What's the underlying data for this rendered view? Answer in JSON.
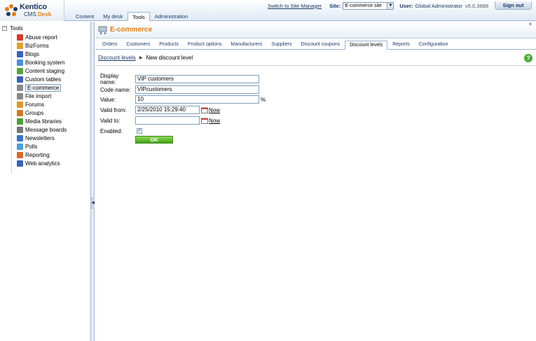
{
  "app": {
    "brand": "Kentico",
    "product_prefix": "CMS",
    "product_suffix": "Desk"
  },
  "main_tabs": [
    "Content",
    "My desk",
    "Tools",
    "Administration"
  ],
  "topbar": {
    "switch_link": "Switch to Site Manager",
    "site_label": "Site:",
    "site_value": "E-commerce site",
    "user_label": "User:",
    "user_value": "Global Administrator",
    "version": "v5.0.3688",
    "sign_out": "Sign out"
  },
  "tree": {
    "root": "Tools",
    "items": [
      {
        "label": "Abuse report",
        "icon": "abuse-report-icon",
        "color": "#d23b2b"
      },
      {
        "label": "BizForms",
        "icon": "bizforms-icon",
        "color": "#e0a030"
      },
      {
        "label": "Blogs",
        "icon": "blogs-icon",
        "color": "#3a62b8"
      },
      {
        "label": "Booking system",
        "icon": "booking-icon",
        "color": "#4a8ed8"
      },
      {
        "label": "Content staging",
        "icon": "staging-icon",
        "color": "#5aa23c"
      },
      {
        "label": "Custom tables",
        "icon": "table-icon",
        "color": "#3a62b8"
      },
      {
        "label": "E-commerce",
        "icon": "cart-icon",
        "color": "#8a8a8a"
      },
      {
        "label": "File import",
        "icon": "file-import-icon",
        "color": "#888888"
      },
      {
        "label": "Forums",
        "icon": "forums-icon",
        "color": "#d89a2a"
      },
      {
        "label": "Groups",
        "icon": "groups-icon",
        "color": "#c87a2a"
      },
      {
        "label": "Media libraries",
        "icon": "media-icon",
        "color": "#4aa03a"
      },
      {
        "label": "Message boards",
        "icon": "message-board-icon",
        "color": "#777777"
      },
      {
        "label": "Newsletters",
        "icon": "newsletter-icon",
        "color": "#3a72c8"
      },
      {
        "label": "Polls",
        "icon": "polls-icon",
        "color": "#4aa0d8"
      },
      {
        "label": "Reporting",
        "icon": "reporting-icon",
        "color": "#d86a2a"
      },
      {
        "label": "Web analytics",
        "icon": "analytics-icon",
        "color": "#3a62b8"
      }
    ]
  },
  "page": {
    "title": "E-commerce",
    "tabs": [
      "Orders",
      "Customers",
      "Products",
      "Product options",
      "Manufacturers",
      "Suppliers",
      "Discount coupons",
      "Discount levels",
      "Reports",
      "Configuration"
    ],
    "breadcrumb": {
      "parent": "Discount levels",
      "current": "New discount level"
    }
  },
  "form": {
    "display_name": {
      "label": "Display name:",
      "value": "VIP customers"
    },
    "code_name": {
      "label": "Code name:",
      "value": "VIPcustomers"
    },
    "value": {
      "label": "Value:",
      "value": "10",
      "unit": "%"
    },
    "valid_from": {
      "label": "Valid from:",
      "value": "2/25/2010 15:29:40",
      "now": "Now"
    },
    "valid_to": {
      "label": "Valid to:",
      "value": "",
      "now": "Now"
    },
    "enabled": {
      "label": "Enabled:",
      "checked": true
    },
    "ok_label": "OK"
  },
  "colors": {
    "accent": "#e37c10",
    "link": "#1d3a66",
    "ok_green": "#42a313",
    "help_green": "#4aa832"
  }
}
